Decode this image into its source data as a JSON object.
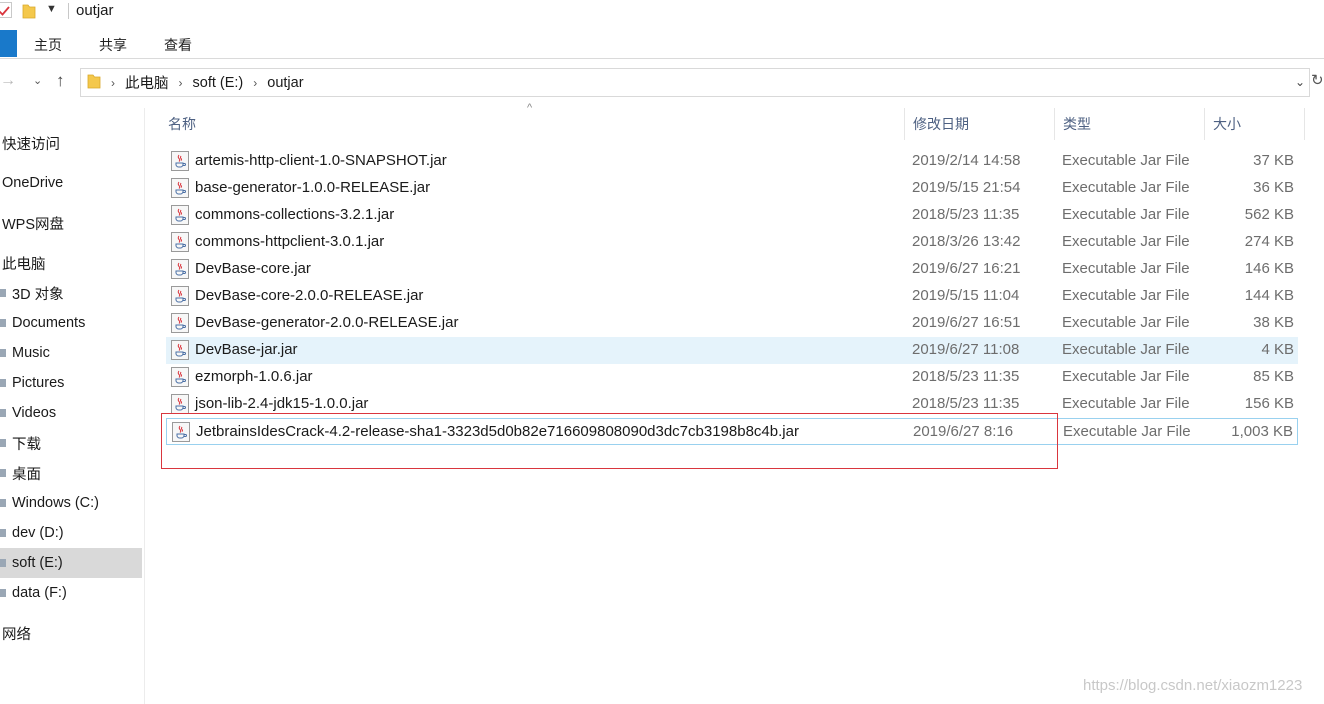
{
  "window": {
    "title": "outjar"
  },
  "ribbon": {
    "tabs": [
      "主页",
      "共享",
      "查看"
    ]
  },
  "address": {
    "crumbs": [
      "此电脑",
      "soft (E:)",
      "outjar"
    ]
  },
  "sidebar": {
    "items": [
      {
        "label": "快速访问",
        "sub": false,
        "selected": false
      },
      {
        "label": "OneDrive",
        "sub": false,
        "selected": false
      },
      {
        "label": "WPS网盘",
        "sub": false,
        "selected": false
      },
      {
        "label": "此电脑",
        "sub": false,
        "selected": false
      },
      {
        "label": "3D 对象",
        "sub": true,
        "selected": false
      },
      {
        "label": "Documents",
        "sub": true,
        "selected": false
      },
      {
        "label": "Music",
        "sub": true,
        "selected": false
      },
      {
        "label": "Pictures",
        "sub": true,
        "selected": false
      },
      {
        "label": "Videos",
        "sub": true,
        "selected": false
      },
      {
        "label": "下载",
        "sub": true,
        "selected": false
      },
      {
        "label": "桌面",
        "sub": true,
        "selected": false
      },
      {
        "label": "Windows (C:)",
        "sub": true,
        "selected": false
      },
      {
        "label": "dev (D:)",
        "sub": true,
        "selected": false
      },
      {
        "label": "soft (E:)",
        "sub": true,
        "selected": true
      },
      {
        "label": "data (F:)",
        "sub": true,
        "selected": false
      },
      {
        "label": "网络",
        "sub": false,
        "selected": false
      }
    ]
  },
  "columns": {
    "name": "名称",
    "date": "修改日期",
    "type": "类型",
    "size": "大小"
  },
  "files": [
    {
      "name": "artemis-http-client-1.0-SNAPSHOT.jar",
      "date": "2019/2/14 14:58",
      "type": "Executable Jar File",
      "size": "37 KB"
    },
    {
      "name": "base-generator-1.0.0-RELEASE.jar",
      "date": "2019/5/15 21:54",
      "type": "Executable Jar File",
      "size": "36 KB"
    },
    {
      "name": "commons-collections-3.2.1.jar",
      "date": "2018/5/23 11:35",
      "type": "Executable Jar File",
      "size": "562 KB"
    },
    {
      "name": "commons-httpclient-3.0.1.jar",
      "date": "2018/3/26 13:42",
      "type": "Executable Jar File",
      "size": "274 KB"
    },
    {
      "name": "DevBase-core.jar",
      "date": "2019/6/27 16:21",
      "type": "Executable Jar File",
      "size": "146 KB"
    },
    {
      "name": "DevBase-core-2.0.0-RELEASE.jar",
      "date": "2019/5/15 11:04",
      "type": "Executable Jar File",
      "size": "144 KB"
    },
    {
      "name": "DevBase-generator-2.0.0-RELEASE.jar",
      "date": "2019/6/27 16:51",
      "type": "Executable Jar File",
      "size": "38 KB"
    },
    {
      "name": "DevBase-jar.jar",
      "date": "2019/6/27 11:08",
      "type": "Executable Jar File",
      "size": "4 KB",
      "state": "selected"
    },
    {
      "name": "ezmorph-1.0.6.jar",
      "date": "2018/5/23 11:35",
      "type": "Executable Jar File",
      "size": "85 KB"
    },
    {
      "name": "json-lib-2.4-jdk15-1.0.0.jar",
      "date": "2018/5/23 11:35",
      "type": "Executable Jar File",
      "size": "156 KB"
    },
    {
      "name": "JetbrainsIdesCrack-4.2-release-sha1-3323d5d0b82e716609808090d3dc7cb3198b8c4b.jar",
      "date": "2019/6/27 8:16",
      "type": "Executable Jar File",
      "size": "1,003 KB",
      "state": "focused"
    }
  ],
  "watermark": "https://blog.csdn.net/xiaozm1223",
  "colors": {
    "accent": "#1979ca",
    "selection": "#e5f3fb",
    "highlight": "#d9363e"
  }
}
